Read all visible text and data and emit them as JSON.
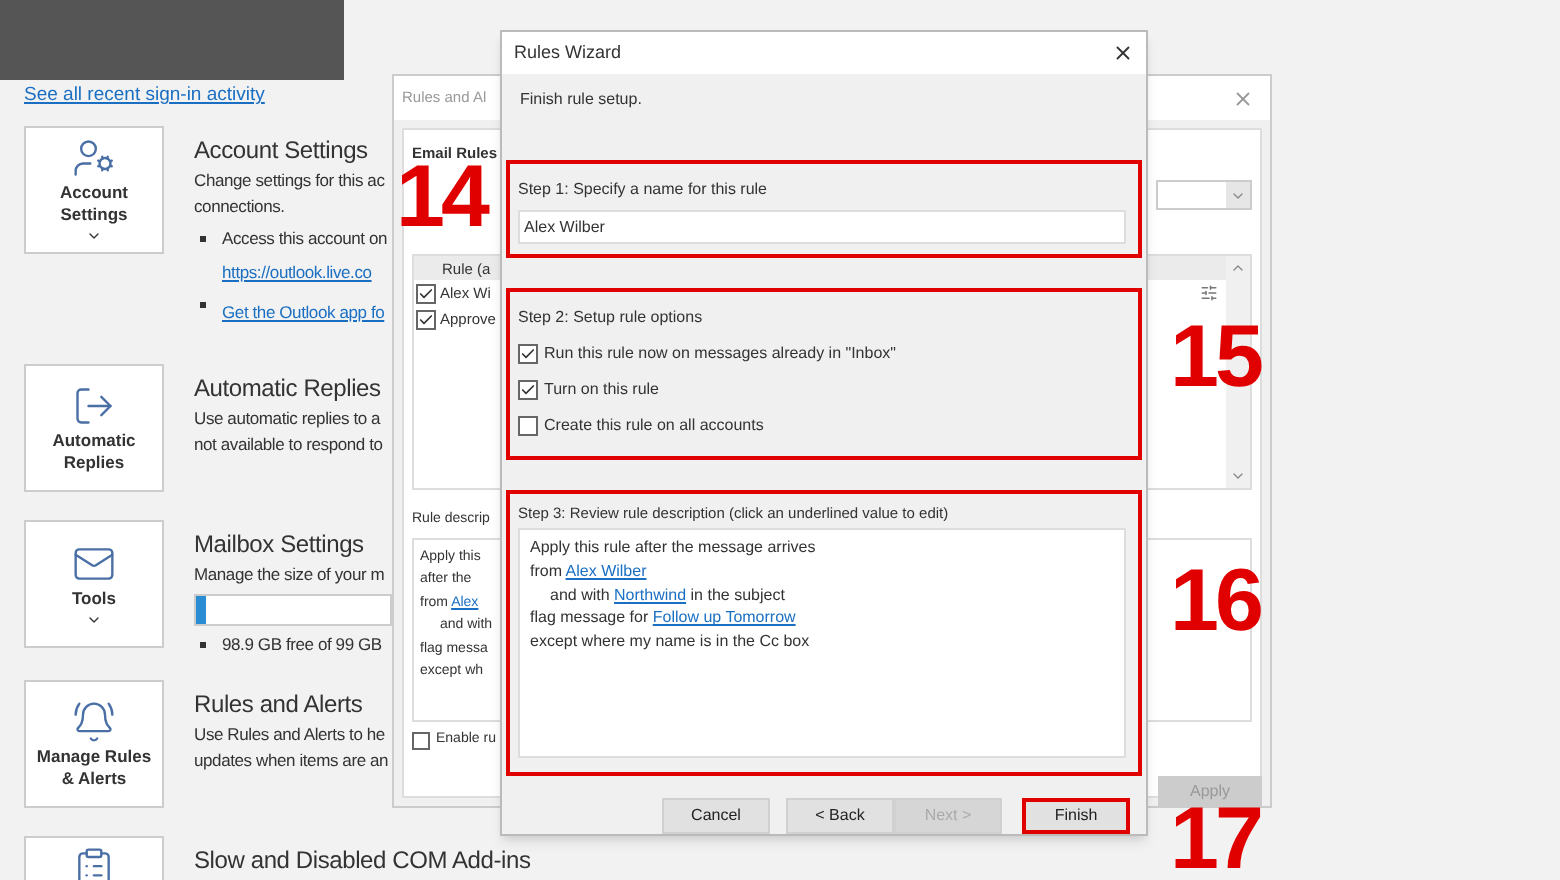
{
  "signin_link": "See all recent sign-in activity",
  "sections": [
    {
      "tile_label": "Account Settings",
      "menu": true,
      "title": "Account Settings",
      "lines": [
        "Change settings for this ac",
        "connections."
      ],
      "bullets": [
        {
          "text": "Access this account on",
          "link": "https://outlook.live.co"
        },
        {
          "link": "Get the Outlook app fo"
        }
      ]
    },
    {
      "tile_label": "Automatic Replies",
      "menu": false,
      "title": "Automatic Replies",
      "lines": [
        "Use automatic replies to a",
        "not available to respond to"
      ]
    },
    {
      "tile_label": "Tools",
      "menu": true,
      "title": "Mailbox Settings",
      "lines": [
        "Manage the size of your m"
      ],
      "usage": {
        "level": 0.05
      },
      "bullets": [
        {
          "text": "98.9 GB free of 99 GB"
        }
      ]
    },
    {
      "tile_label": "Manage Rules & Alerts",
      "menu": false,
      "title": "Rules and Alerts",
      "lines": [
        "Use Rules and Alerts to he",
        "updates when items are an"
      ]
    },
    {
      "title": "Slow and Disabled COM Add-ins"
    }
  ],
  "rules_dialog": {
    "title": "Rules and Al",
    "tab": "Email Rules",
    "column": "Rule (a",
    "rules": [
      {
        "name": "Alex Wi",
        "checked": true
      },
      {
        "name": "Approve",
        "checked": true
      }
    ],
    "description_label": "Rule descrip",
    "description": [
      {
        "segments": [
          {
            "text": "Apply this"
          }
        ]
      },
      {
        "segments": [
          {
            "text": "after the"
          }
        ]
      },
      {
        "segments": [
          {
            "text": "from "
          },
          {
            "text": "Alex",
            "link": true
          }
        ]
      },
      {
        "indented": true,
        "segments": [
          {
            "text": "and with"
          }
        ]
      },
      {
        "segments": [
          {
            "text": "flag messa"
          }
        ]
      },
      {
        "segments": [
          {
            "text": "except wh"
          }
        ]
      }
    ],
    "enable_label": "Enable ru",
    "enable_checked": false,
    "apply_button": {
      "label": "Apply",
      "disabled": true
    }
  },
  "wizard": {
    "title": "Rules Wizard",
    "subtitle": "Finish rule setup.",
    "step1": {
      "label": "Step 1: Specify a name for this rule",
      "value": "Alex Wilber",
      "highlighted": true
    },
    "step2": {
      "label": "Step 2: Setup rule options",
      "highlighted": true,
      "options": [
        {
          "label": "Run this rule now on messages already in \"Inbox\"",
          "checked": true
        },
        {
          "label": "Turn on this rule",
          "checked": true
        },
        {
          "label": "Create this rule on all accounts",
          "checked": false
        }
      ]
    },
    "step3": {
      "label": "Step 3: Review rule description (click an underlined value to edit)",
      "highlighted": true,
      "description": [
        {
          "segments": [
            {
              "text": "Apply this rule after the message arrives"
            }
          ]
        },
        {
          "segments": [
            {
              "text": "from "
            },
            {
              "text": "Alex Wilber",
              "link": true
            }
          ]
        },
        {
          "indented": true,
          "segments": [
            {
              "text": "and with "
            },
            {
              "text": "Northwind",
              "link": true
            },
            {
              "text": " in the subject"
            }
          ]
        },
        {
          "segments": [
            {
              "text": "flag message for "
            },
            {
              "text": "Follow up Tomorrow",
              "link": true
            }
          ]
        },
        {
          "segments": [
            {
              "text": "except where my name is in the Cc box"
            }
          ]
        }
      ]
    },
    "buttons": [
      {
        "label": "Cancel",
        "disabled": false,
        "highlighted": false
      },
      {
        "label": "< Back",
        "disabled": false,
        "highlighted": false
      },
      {
        "label": "Next >",
        "disabled": true,
        "highlighted": false
      },
      {
        "label": "Finish",
        "disabled": false,
        "highlighted": true
      }
    ]
  },
  "callouts": [
    "14",
    "15",
    "16",
    "17"
  ]
}
